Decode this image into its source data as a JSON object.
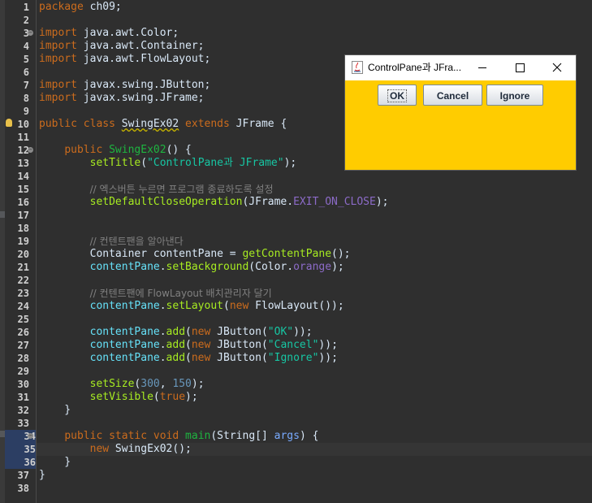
{
  "editor": {
    "lines": [
      {
        "n": "1",
        "tokens": [
          {
            "t": "package",
            "c": "kw"
          },
          {
            "t": " ch09;",
            "c": "ty"
          }
        ]
      },
      {
        "n": "2",
        "tokens": []
      },
      {
        "n": "3",
        "fold": true,
        "tokens": [
          {
            "t": "import",
            "c": "kw"
          },
          {
            "t": " java.awt.Color;",
            "c": "ty"
          }
        ]
      },
      {
        "n": "4",
        "tokens": [
          {
            "t": "import",
            "c": "kw"
          },
          {
            "t": " java.awt.Container;",
            "c": "ty"
          }
        ]
      },
      {
        "n": "5",
        "tokens": [
          {
            "t": "import",
            "c": "kw"
          },
          {
            "t": " java.awt.FlowLayout;",
            "c": "ty"
          }
        ]
      },
      {
        "n": "6",
        "tokens": []
      },
      {
        "n": "7",
        "tokens": [
          {
            "t": "import",
            "c": "kw"
          },
          {
            "t": " javax.swing.JButton;",
            "c": "ty"
          }
        ]
      },
      {
        "n": "8",
        "tokens": [
          {
            "t": "import",
            "c": "kw"
          },
          {
            "t": " javax.swing.JFrame;",
            "c": "ty"
          }
        ]
      },
      {
        "n": "9",
        "tokens": []
      },
      {
        "n": "10",
        "bulb": true,
        "tokens": [
          {
            "t": "public",
            "c": "kw"
          },
          {
            "t": " ",
            "c": "ty"
          },
          {
            "t": "class",
            "c": "kw"
          },
          {
            "t": " ",
            "c": "ty"
          },
          {
            "t": "SwingEx02",
            "c": "cls"
          },
          {
            "t": " ",
            "c": "ty"
          },
          {
            "t": "extends",
            "c": "kw"
          },
          {
            "t": " JFrame {",
            "c": "ty"
          }
        ]
      },
      {
        "n": "11",
        "tokens": []
      },
      {
        "n": "12",
        "fold": true,
        "tokens": [
          {
            "t": "    ",
            "c": "ty"
          },
          {
            "t": "public",
            "c": "kw"
          },
          {
            "t": " ",
            "c": "ty"
          },
          {
            "t": "SwingEx02",
            "c": "mdecl"
          },
          {
            "t": "() {",
            "c": "ty"
          }
        ]
      },
      {
        "n": "13",
        "tokens": [
          {
            "t": "        ",
            "c": "ty"
          },
          {
            "t": "setTitle",
            "c": "meth"
          },
          {
            "t": "(",
            "c": "ty"
          },
          {
            "t": "\"ControlPane과 JFrame\"",
            "c": "str"
          },
          {
            "t": ");",
            "c": "ty"
          }
        ]
      },
      {
        "n": "14",
        "tokens": []
      },
      {
        "n": "15",
        "tokens": [
          {
            "t": "        ",
            "c": "ty"
          },
          {
            "t": "// 엑스버튼 누르면 프로그램 종료하도록 설정",
            "c": "com"
          }
        ]
      },
      {
        "n": "16",
        "tokens": [
          {
            "t": "        ",
            "c": "ty"
          },
          {
            "t": "setDefaultCloseOperation",
            "c": "meth"
          },
          {
            "t": "(JFrame.",
            "c": "ty"
          },
          {
            "t": "EXIT_ON_CLOSE",
            "c": "cst"
          },
          {
            "t": ");",
            "c": "ty"
          }
        ]
      },
      {
        "n": "17",
        "tokens": []
      },
      {
        "n": "18",
        "tokens": []
      },
      {
        "n": "19",
        "tokens": [
          {
            "t": "        ",
            "c": "ty"
          },
          {
            "t": "// 컨텐트팬을 알아낸다",
            "c": "com"
          }
        ]
      },
      {
        "n": "20",
        "tokens": [
          {
            "t": "        Container contentPane = ",
            "c": "ty"
          },
          {
            "t": "getContentPane",
            "c": "meth"
          },
          {
            "t": "();",
            "c": "ty"
          }
        ]
      },
      {
        "n": "21",
        "tokens": [
          {
            "t": "        ",
            "c": "ty"
          },
          {
            "t": "contentPane",
            "c": "fld"
          },
          {
            "t": ".",
            "c": "ty"
          },
          {
            "t": "setBackground",
            "c": "meth"
          },
          {
            "t": "(Color.",
            "c": "ty"
          },
          {
            "t": "orange",
            "c": "cst"
          },
          {
            "t": ");",
            "c": "ty"
          }
        ]
      },
      {
        "n": "22",
        "tokens": []
      },
      {
        "n": "23",
        "tokens": [
          {
            "t": "        ",
            "c": "ty"
          },
          {
            "t": "// 컨텐트팬에 FlowLayout 배치관리자 달기",
            "c": "com"
          }
        ]
      },
      {
        "n": "24",
        "tokens": [
          {
            "t": "        ",
            "c": "ty"
          },
          {
            "t": "contentPane",
            "c": "fld"
          },
          {
            "t": ".",
            "c": "ty"
          },
          {
            "t": "setLayout",
            "c": "meth"
          },
          {
            "t": "(",
            "c": "ty"
          },
          {
            "t": "new",
            "c": "kw"
          },
          {
            "t": " FlowLayout());",
            "c": "ty"
          }
        ]
      },
      {
        "n": "25",
        "tokens": []
      },
      {
        "n": "26",
        "tokens": [
          {
            "t": "        ",
            "c": "ty"
          },
          {
            "t": "contentPane",
            "c": "fld"
          },
          {
            "t": ".",
            "c": "ty"
          },
          {
            "t": "add",
            "c": "meth"
          },
          {
            "t": "(",
            "c": "ty"
          },
          {
            "t": "new",
            "c": "kw"
          },
          {
            "t": " JButton(",
            "c": "ty"
          },
          {
            "t": "\"OK\"",
            "c": "str"
          },
          {
            "t": "));",
            "c": "ty"
          }
        ]
      },
      {
        "n": "27",
        "tokens": [
          {
            "t": "        ",
            "c": "ty"
          },
          {
            "t": "contentPane",
            "c": "fld"
          },
          {
            "t": ".",
            "c": "ty"
          },
          {
            "t": "add",
            "c": "meth"
          },
          {
            "t": "(",
            "c": "ty"
          },
          {
            "t": "new",
            "c": "kw"
          },
          {
            "t": " JButton(",
            "c": "ty"
          },
          {
            "t": "\"Cancel\"",
            "c": "str"
          },
          {
            "t": "));",
            "c": "ty"
          }
        ]
      },
      {
        "n": "28",
        "tokens": [
          {
            "t": "        ",
            "c": "ty"
          },
          {
            "t": "contentPane",
            "c": "fld"
          },
          {
            "t": ".",
            "c": "ty"
          },
          {
            "t": "add",
            "c": "meth"
          },
          {
            "t": "(",
            "c": "ty"
          },
          {
            "t": "new",
            "c": "kw"
          },
          {
            "t": " JButton(",
            "c": "ty"
          },
          {
            "t": "\"Ignore\"",
            "c": "str"
          },
          {
            "t": "));",
            "c": "ty"
          }
        ]
      },
      {
        "n": "29",
        "tokens": []
      },
      {
        "n": "30",
        "tokens": [
          {
            "t": "        ",
            "c": "ty"
          },
          {
            "t": "setSize",
            "c": "meth"
          },
          {
            "t": "(",
            "c": "ty"
          },
          {
            "t": "300",
            "c": "num"
          },
          {
            "t": ", ",
            "c": "ty"
          },
          {
            "t": "150",
            "c": "num"
          },
          {
            "t": ");",
            "c": "ty"
          }
        ]
      },
      {
        "n": "31",
        "tokens": [
          {
            "t": "        ",
            "c": "ty"
          },
          {
            "t": "setVisible",
            "c": "meth"
          },
          {
            "t": "(",
            "c": "ty"
          },
          {
            "t": "true",
            "c": "bool"
          },
          {
            "t": ");",
            "c": "ty"
          }
        ]
      },
      {
        "n": "32",
        "tokens": [
          {
            "t": "    }",
            "c": "ty"
          }
        ]
      },
      {
        "n": "33",
        "tokens": []
      },
      {
        "n": "34",
        "fold": true,
        "hl": true,
        "tokens": [
          {
            "t": "    ",
            "c": "ty"
          },
          {
            "t": "public",
            "c": "kw"
          },
          {
            "t": " ",
            "c": "ty"
          },
          {
            "t": "static",
            "c": "kw"
          },
          {
            "t": " ",
            "c": "ty"
          },
          {
            "t": "void",
            "c": "kw"
          },
          {
            "t": " ",
            "c": "ty"
          },
          {
            "t": "main",
            "c": "mdecl"
          },
          {
            "t": "(String[] ",
            "c": "ty"
          },
          {
            "t": "args",
            "c": "param"
          },
          {
            "t": ") {",
            "c": "ty"
          }
        ]
      },
      {
        "n": "35",
        "current": true,
        "hl": true,
        "tokens": [
          {
            "t": "        ",
            "c": "ty"
          },
          {
            "t": "new",
            "c": "kw"
          },
          {
            "t": " SwingEx02();",
            "c": "ty"
          }
        ]
      },
      {
        "n": "36",
        "hl": true,
        "tokens": [
          {
            "t": "    }",
            "c": "ty"
          }
        ]
      },
      {
        "n": "37",
        "tokens": [
          {
            "t": "}",
            "c": "ty"
          }
        ]
      },
      {
        "n": "38",
        "tokens": []
      }
    ]
  },
  "window": {
    "title": "ControlPane과 JFra...",
    "java_icon": "java-icon",
    "controls": [
      "minimize-icon",
      "maximize-icon",
      "close-icon"
    ],
    "background": "#ffcc00",
    "buttons": [
      {
        "label": "OK"
      },
      {
        "label": "Cancel"
      },
      {
        "label": "Ignore"
      }
    ]
  },
  "colors": {
    "editor_bg": "#2f2f2f",
    "keyword": "#cc6c1d",
    "string": "#17c6a3",
    "comment": "#808080",
    "field": "#66e1f8",
    "constant": "#8c6bc8",
    "method_call": "#a7ec21",
    "method_decl": "#1eb540"
  }
}
